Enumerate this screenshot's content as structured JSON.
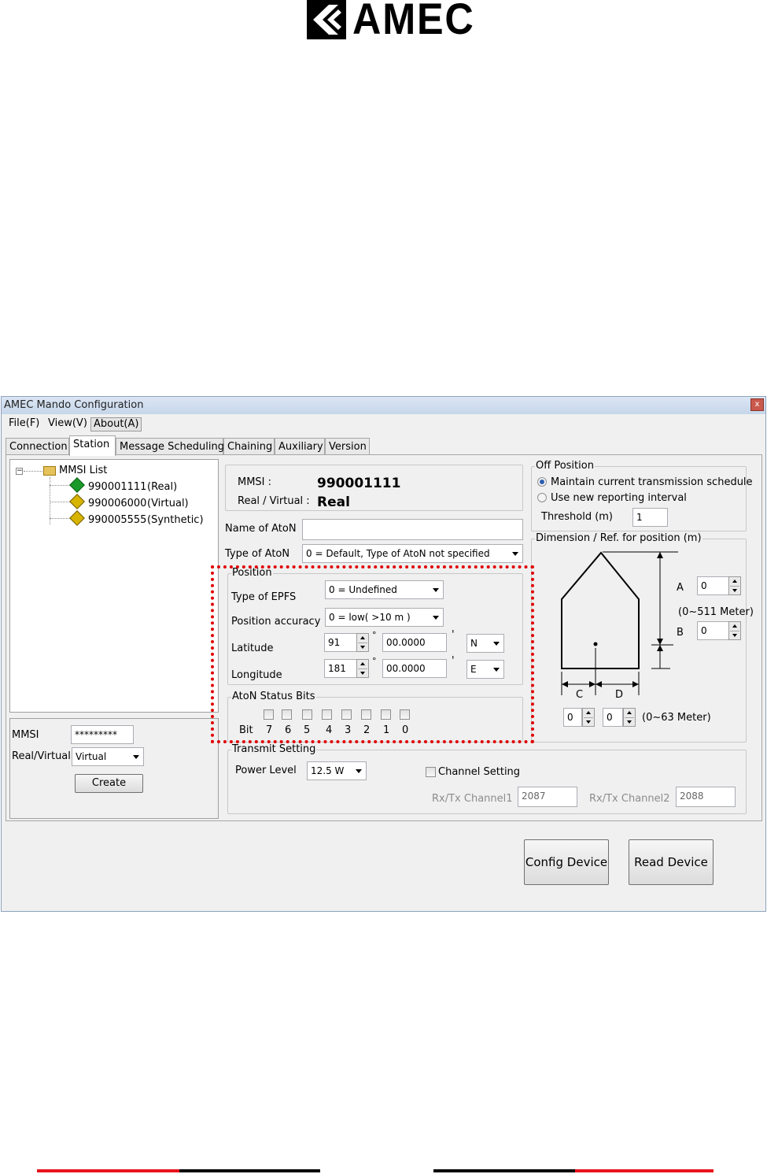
{
  "logo": {
    "text": "AMEC"
  },
  "window": {
    "title": "AMEC Mando Configuration",
    "close_glyph": "x",
    "menu": [
      "File(F)",
      "View(V)",
      "About(A)"
    ],
    "tabs": [
      "Connection",
      "Station",
      "Message Scheduling",
      "Chaining",
      "Auxiliary",
      "Version"
    ],
    "active_tab": "Station"
  },
  "tree": {
    "root": "MMSI List",
    "items": [
      {
        "mmsi": "990001111",
        "kind": "(Real)",
        "icon_color": "#1a9a2a"
      },
      {
        "mmsi": "990006000",
        "kind": "(Virtual)",
        "icon_color": "#d7b400"
      },
      {
        "mmsi": "990005555",
        "kind": "(Synthetic)",
        "icon_color": "#d7b400"
      }
    ]
  },
  "create_form": {
    "mmsi_label": "MMSI",
    "mmsi_value": "*********",
    "realvirtual_label": "Real/Virtual",
    "realvirtual_value": "Virtual",
    "create_button": "Create"
  },
  "info": {
    "mmsi_label": "MMSI :",
    "mmsi_value": "990001111",
    "rv_label": "Real / Virtual :",
    "rv_value": "Real"
  },
  "name_of_aton": {
    "label": "Name of AtoN",
    "value": ""
  },
  "type_of_aton": {
    "label": "Type of AtoN",
    "value": "0 = Default, Type of AtoN not specified"
  },
  "position": {
    "legend": "Position",
    "epfs_label": "Type of EPFS",
    "epfs_value": "0 = Undefined",
    "accuracy_label": "Position accuracy",
    "accuracy_value": "0 = low( >10 m )",
    "lat_label": "Latitude",
    "lat_deg": "91",
    "lat_min": "00.0000",
    "lat_dir": "N",
    "lon_label": "Longitude",
    "lon_deg": "181",
    "lon_min": "00.0000",
    "lon_dir": "E",
    "deg_symbol": "°",
    "min_symbol": "'"
  },
  "status_bits": {
    "legend": "AtoN Status Bits",
    "bit_label": "Bit",
    "bits": [
      "7",
      "6",
      "5",
      "4",
      "3",
      "2",
      "1",
      "0"
    ]
  },
  "transmit": {
    "legend": "Transmit Setting",
    "power_label": "Power Level",
    "power_value": "12.5 W",
    "channel_setting_label": "Channel Setting",
    "ch1_label": "Rx/Tx Channel1",
    "ch1_value": "2087",
    "ch2_label": "Rx/Tx Channel2",
    "ch2_value": "2088"
  },
  "off_position": {
    "legend": "Off Position",
    "option1": "Maintain current transmission schedule",
    "option2": "Use new reporting interval",
    "selected": 1,
    "threshold_label": "Threshold (m)",
    "threshold_value": "1"
  },
  "dimension": {
    "legend": "Dimension / Ref. for position (m)",
    "a_label": "A",
    "a_value": "0",
    "range_ab": "(0~511 Meter)",
    "b_label": "B",
    "b_value": "0",
    "c_label": "C",
    "d_label": "D",
    "c_value": "0",
    "d_value": "0",
    "range_cd": "(0~63 Meter)"
  },
  "buttons": {
    "config": "Config Device",
    "read": "Read Device"
  },
  "colors": {
    "highlight": "#e00000",
    "footer_red": "#e8141b",
    "footer_black": "#000000"
  }
}
